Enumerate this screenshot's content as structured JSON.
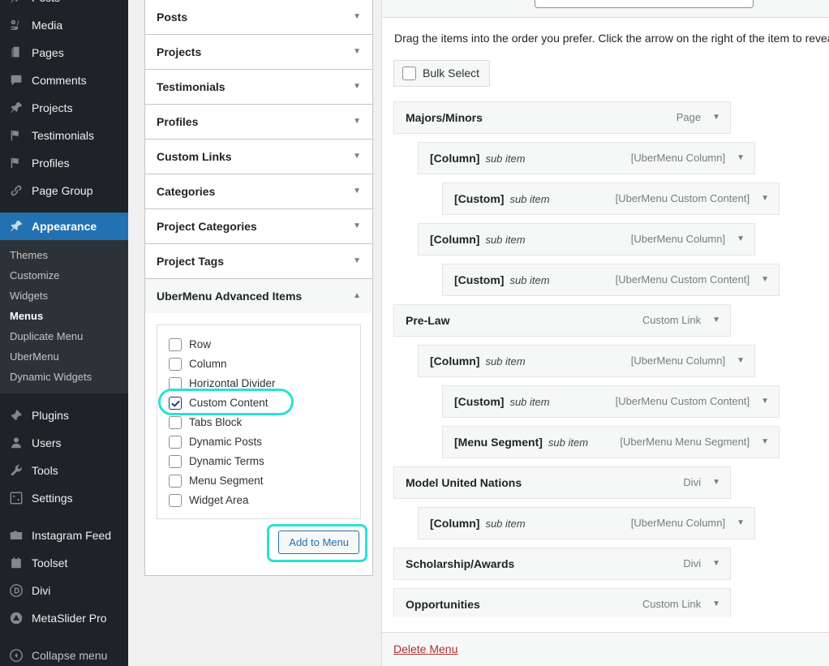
{
  "sidebar": {
    "items": [
      {
        "label": "Posts",
        "icon": "pin-icon",
        "partial": true
      },
      {
        "label": "Media",
        "icon": "media-icon"
      },
      {
        "label": "Pages",
        "icon": "pages-icon"
      },
      {
        "label": "Comments",
        "icon": "comments-icon"
      },
      {
        "label": "Projects",
        "icon": "pin-icon"
      },
      {
        "label": "Testimonials",
        "icon": "flag-icon"
      },
      {
        "label": "Profiles",
        "icon": "flag-icon"
      },
      {
        "label": "Page Group",
        "icon": "link-icon"
      },
      {
        "label": "Appearance",
        "icon": "brush-icon",
        "current": true
      }
    ],
    "appearance_submenu": [
      {
        "label": "Themes"
      },
      {
        "label": "Customize"
      },
      {
        "label": "Widgets"
      },
      {
        "label": "Menus",
        "current": true
      },
      {
        "label": "Duplicate Menu"
      },
      {
        "label": "UberMenu"
      },
      {
        "label": "Dynamic Widgets"
      }
    ],
    "items_lower": [
      {
        "label": "Plugins",
        "icon": "plug-icon"
      },
      {
        "label": "Users",
        "icon": "user-icon"
      },
      {
        "label": "Tools",
        "icon": "wrench-icon"
      },
      {
        "label": "Settings",
        "icon": "sliders-icon"
      }
    ],
    "items_plugins": [
      {
        "label": "Instagram Feed",
        "icon": "camera-icon"
      },
      {
        "label": "Toolset",
        "icon": "toolset-icon"
      },
      {
        "label": "Divi",
        "icon": "divi-icon"
      },
      {
        "label": "MetaSlider Pro",
        "icon": "metaslider-icon"
      }
    ],
    "collapse": {
      "label": "Collapse menu",
      "icon": "collapse-arrow-icon"
    }
  },
  "accordion": {
    "panels": [
      {
        "label": "Posts",
        "open": false
      },
      {
        "label": "Projects",
        "open": false
      },
      {
        "label": "Testimonials",
        "open": false
      },
      {
        "label": "Profiles",
        "open": false
      },
      {
        "label": "Custom Links",
        "open": false
      },
      {
        "label": "Categories",
        "open": false
      },
      {
        "label": "Project Categories",
        "open": false
      },
      {
        "label": "Project Tags",
        "open": false
      },
      {
        "label": "UberMenu Advanced Items",
        "open": true
      }
    ],
    "advanced_items": [
      {
        "label": "Row",
        "checked": false
      },
      {
        "label": "Column",
        "checked": false
      },
      {
        "label": "Horizontal Divider",
        "checked": false
      },
      {
        "label": "Custom Content",
        "checked": true,
        "highlighted": true
      },
      {
        "label": "Tabs Block",
        "checked": false
      },
      {
        "label": "Dynamic Posts",
        "checked": false
      },
      {
        "label": "Dynamic Terms",
        "checked": false
      },
      {
        "label": "Menu Segment",
        "checked": false
      },
      {
        "label": "Widget Area",
        "checked": false
      }
    ],
    "add_to_menu_label": "Add to Menu",
    "caret_closed": "▼",
    "caret_open": "▲"
  },
  "main": {
    "drag_hint": "Drag the items into the order you prefer. Click the arrow on the right of the item to revea",
    "bulk_select_label": "Bulk Select",
    "arrow_glyph": "▼",
    "delete_menu_label": "Delete Menu",
    "menu_items": [
      {
        "title": "Majors/Minors",
        "subtext": "",
        "type": "Page",
        "depth": 0
      },
      {
        "title": "[Column]",
        "subtext": "sub item",
        "type": "[UberMenu Column]",
        "depth": 1
      },
      {
        "title": "[Custom]",
        "subtext": "sub item",
        "type": "[UberMenu Custom Content]",
        "depth": 2
      },
      {
        "title": "[Column]",
        "subtext": "sub item",
        "type": "[UberMenu Column]",
        "depth": 1
      },
      {
        "title": "[Custom]",
        "subtext": "sub item",
        "type": "[UberMenu Custom Content]",
        "depth": 2
      },
      {
        "title": "Pre-Law",
        "subtext": "",
        "type": "Custom Link",
        "depth": 0
      },
      {
        "title": "[Column]",
        "subtext": "sub item",
        "type": "[UberMenu Column]",
        "depth": 1
      },
      {
        "title": "[Custom]",
        "subtext": "sub item",
        "type": "[UberMenu Custom Content]",
        "depth": 2
      },
      {
        "title": "[Menu Segment]",
        "subtext": "sub item",
        "type": "[UberMenu Menu Segment]",
        "depth": 2
      },
      {
        "title": "Model United Nations",
        "subtext": "",
        "type": "Divi",
        "depth": 0
      },
      {
        "title": "[Column]",
        "subtext": "sub item",
        "type": "[UberMenu Column]",
        "depth": 1
      },
      {
        "title": "Scholarship/Awards",
        "subtext": "",
        "type": "Divi",
        "depth": 0
      },
      {
        "title": "Opportunities",
        "subtext": "",
        "type": "Custom Link",
        "depth": 0
      },
      {
        "title": "",
        "subtext": "",
        "type": "",
        "depth": 1
      }
    ]
  },
  "colors": {
    "highlight_ring": "#2ae0d5",
    "sidebar_bg": "#1d2327",
    "sidebar_current": "#2271b1",
    "delete_link": "#b32d2e",
    "checkbox_checked": "#1d3c6e"
  }
}
